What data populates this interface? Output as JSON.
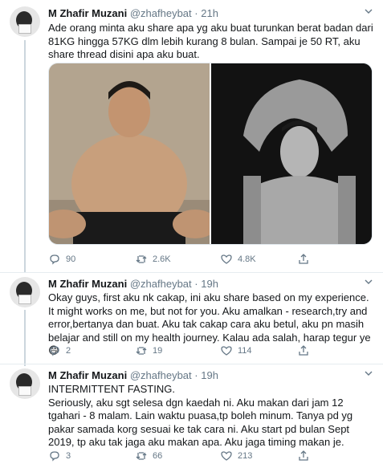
{
  "tweets": [
    {
      "name": "M Zhafir Muzani",
      "handle": "@zhafheybat",
      "time": "21h",
      "text": "Ade orang minta aku share apa yg aku buat turunkan berat badan dari 81KG hingga 57KG dlm lebih kurang 8 bulan. Sampai je 50 RT, aku share thread disini apa aku buat.",
      "replies": "90",
      "retweets": "2.6K",
      "likes": "4.8K"
    },
    {
      "name": "M Zhafir Muzani",
      "handle": "@zhafheybat",
      "time": "19h",
      "text": "Okay guys, first aku nk cakap, ini aku share based on my experience. It might works on me, but not for you. Aku amalkan - research,try and error,bertanya dan buat. Aku tak cakap cara aku betul, aku pn masih belajar and still on my health journey. Kalau ada salah, harap tegur ye😄",
      "replies": "2",
      "retweets": "19",
      "likes": "114"
    },
    {
      "name": "M Zhafir Muzani",
      "handle": "@zhafheybat",
      "time": "19h",
      "text": "INTERMITTENT FASTING.\nSeriously, aku sgt selesa dgn kaedah ni. Aku makan dari jam 12 tgahari - 8 malam. Lain waktu puasa,tp boleh minum. Tanya pd yg pakar samada korg sesuai ke tak cara ni. Aku start pd bulan Sept 2019, tp aku tak jaga aku makan apa. Aku jaga timing makan je.",
      "replies": "3",
      "retweets": "66",
      "likes": "213"
    }
  ],
  "separator": "·",
  "icons": {
    "reply": "reply-icon",
    "retweet": "retweet-icon",
    "like": "heart-icon",
    "share": "share-icon",
    "menu": "chevron-down-icon"
  }
}
